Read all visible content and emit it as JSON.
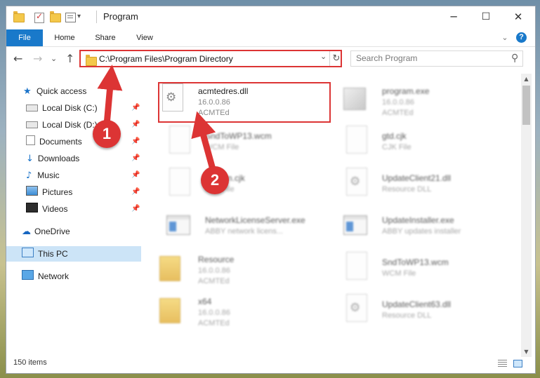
{
  "window": {
    "title": "Program",
    "min_glyph": "─",
    "max_glyph": "☐",
    "close_glyph": "✕",
    "qa_dropdown_glyph": "▾"
  },
  "ribbon": {
    "tabs": [
      "File",
      "Home",
      "Share",
      "View"
    ],
    "expand_glyph": "⌄",
    "help_glyph": "?"
  },
  "nav": {
    "back_glyph": "←",
    "forward_glyph": "→",
    "recent_glyph": "⌄",
    "up_glyph": "↑"
  },
  "address": {
    "path": "C:\\Program Files\\Program Directory",
    "dropdown_glyph": "⌄",
    "refresh_glyph": "↻"
  },
  "search": {
    "placeholder": "Search Program",
    "icon_glyph": "⚲"
  },
  "sidebar": {
    "pin_glyph": "📌",
    "items": [
      {
        "label": "Quick access",
        "icon": "star-icon",
        "glyph": "★"
      },
      {
        "label": "Local Disk (C:)",
        "icon": "drive-icon"
      },
      {
        "label": "Local Disk (D:)",
        "icon": "drive-icon"
      },
      {
        "label": "Documents",
        "icon": "documents-icon"
      },
      {
        "label": "Downloads",
        "icon": "download-icon",
        "glyph": "↓"
      },
      {
        "label": "Music",
        "icon": "music-icon",
        "glyph": "♪"
      },
      {
        "label": "Pictures",
        "icon": "pictures-icon"
      },
      {
        "label": "Videos",
        "icon": "videos-icon"
      },
      {
        "label": "OneDrive",
        "icon": "cloud-icon",
        "glyph": "☁"
      },
      {
        "label": "This PC",
        "icon": "computer-icon",
        "selected": true
      },
      {
        "label": "Network",
        "icon": "network-icon"
      }
    ]
  },
  "files": [
    {
      "name": "acmtedres.dll",
      "line1": "16.0.0.86",
      "line2": "ACMTEd",
      "icon": "dll-icon",
      "highlighted": true
    },
    {
      "name": "program.exe",
      "line1": "16.0.0.86",
      "line2": "ACMTEd",
      "icon": "exe-icon"
    },
    {
      "name": "SndToWP13.wcm",
      "line1": "WCM File",
      "line2": "",
      "icon": "file-icon"
    },
    {
      "name": "gtd.cjk",
      "line1": "CJK File",
      "line2": "",
      "icon": "file-icon"
    },
    {
      "name": "Korean.cjk",
      "line1": "CJK File",
      "line2": "",
      "icon": "file-icon"
    },
    {
      "name": "UpdateClient21.dll",
      "line1": "Resource DLL",
      "line2": "",
      "icon": "dll-icon"
    },
    {
      "name": "NetworkLicenseServer.exe",
      "line1": "ABBY network licens...",
      "line2": "",
      "icon": "exe-icon"
    },
    {
      "name": "UpdateInstaller.exe",
      "line1": "ABBY updates installer",
      "line2": "",
      "icon": "exe-icon"
    },
    {
      "name": "Resource",
      "line1": "16.0.0.86",
      "line2": "ACMTEd",
      "icon": "folder-icon"
    },
    {
      "name": "SndToWP13.wcm",
      "line1": "WCM File",
      "line2": "",
      "icon": "file-icon"
    },
    {
      "name": "x64",
      "line1": "16.0.0.86",
      "line2": "ACMTEd",
      "icon": "folder-icon"
    },
    {
      "name": "UpdateClient63.dll",
      "line1": "Resource DLL",
      "line2": "",
      "icon": "dll-icon"
    }
  ],
  "scrollbar": {
    "up_glyph": "▲",
    "down_glyph": "▼"
  },
  "status": {
    "item_count": "150 items"
  },
  "callouts": [
    {
      "number": "1"
    },
    {
      "number": "2"
    }
  ],
  "colors": {
    "accent": "#1979ca",
    "highlight_red": "#dc3434",
    "selection": "#cce4f7"
  }
}
